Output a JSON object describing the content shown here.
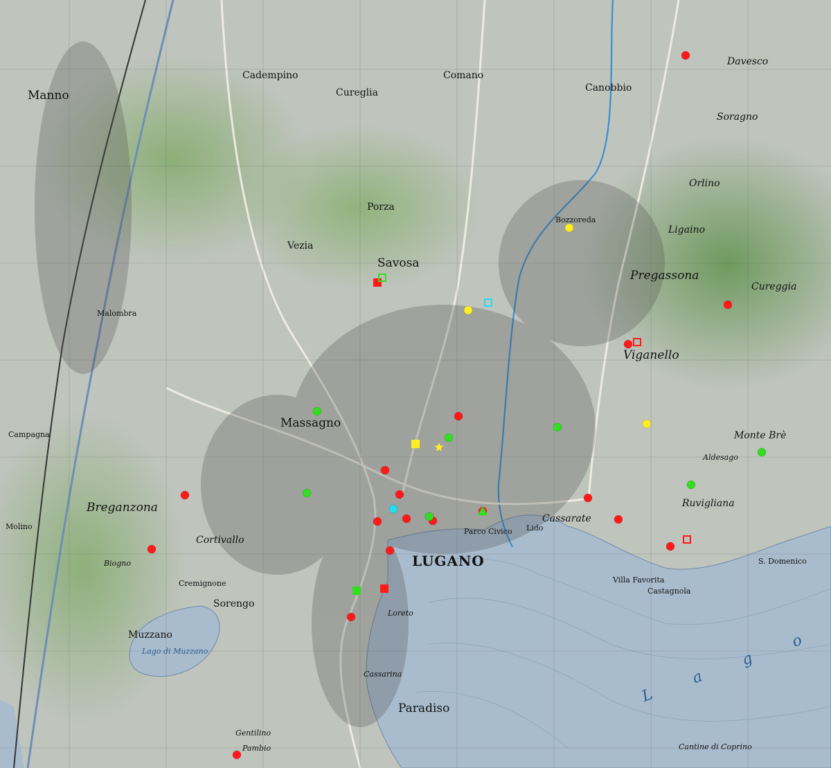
{
  "map": {
    "places": [
      {
        "name": "Manno",
        "style": "big"
      },
      {
        "name": "Cadempino",
        "style": "mid"
      },
      {
        "name": "Comano",
        "style": "mid"
      },
      {
        "name": "Cureglia",
        "style": "mid"
      },
      {
        "name": "Canobbio",
        "style": "mid"
      },
      {
        "name": "Davesco",
        "style": "mid it"
      },
      {
        "name": "Soragno",
        "style": "mid it"
      },
      {
        "name": "Orlino",
        "style": "mid it"
      },
      {
        "name": "Porza",
        "style": "mid"
      },
      {
        "name": "Vezia",
        "style": "mid"
      },
      {
        "name": "Savosa",
        "style": "big"
      },
      {
        "name": "Bozzoreda",
        "style": "sm"
      },
      {
        "name": "Ligaino",
        "style": "mid it"
      },
      {
        "name": "Pregassona",
        "style": "big it"
      },
      {
        "name": "Cureggia",
        "style": "mid it"
      },
      {
        "name": "Viganello",
        "style": "big it"
      },
      {
        "name": "Massagno",
        "style": "big"
      },
      {
        "name": "Monte Brè",
        "style": "mid it"
      },
      {
        "name": "Aldesago",
        "style": "sm it"
      },
      {
        "name": "Ruvigliana",
        "style": "mid it"
      },
      {
        "name": "Breganzona",
        "style": "big it"
      },
      {
        "name": "Cortivallo",
        "style": "mid it"
      },
      {
        "name": "Biogno",
        "style": "sm it"
      },
      {
        "name": "Cremignone",
        "style": "sm"
      },
      {
        "name": "Sorengo",
        "style": "mid"
      },
      {
        "name": "Cassarate",
        "style": "mid it"
      },
      {
        "name": "Lido",
        "style": "sm"
      },
      {
        "name": "LUGANO",
        "style": "lugano"
      },
      {
        "name": "Castagnola",
        "style": "sm"
      },
      {
        "name": "Villa Favorita",
        "style": "sm"
      },
      {
        "name": "S. Domenico",
        "style": "sm"
      },
      {
        "name": "Loreto",
        "style": "sm it"
      },
      {
        "name": "Muzzano",
        "style": "mid"
      },
      {
        "name": "Lago di Muzzano",
        "style": "sm water"
      },
      {
        "name": "Cassarina",
        "style": "sm it"
      },
      {
        "name": "Paradiso",
        "style": "big"
      },
      {
        "name": "Gentilino",
        "style": "sm it"
      },
      {
        "name": "Pambio",
        "style": "sm it"
      },
      {
        "name": "Cantine di Coprino",
        "style": "sm it"
      },
      {
        "name": "Malombra",
        "style": "sm"
      },
      {
        "name": "Campagna",
        "style": "sm"
      },
      {
        "name": "Molino",
        "style": "sm"
      },
      {
        "name": "Parco Civico",
        "style": "sm"
      }
    ],
    "lake_label": "L a g o",
    "markers": [
      {
        "type": "dot",
        "color": "#ff1a1a"
      },
      {
        "type": "dot",
        "color": "#ff1a1a"
      },
      {
        "type": "dot",
        "color": "#ff1a1a"
      },
      {
        "type": "dot",
        "color": "#ff1a1a"
      },
      {
        "type": "dot",
        "color": "#ff1a1a"
      },
      {
        "type": "dot",
        "color": "#ff1a1a"
      },
      {
        "type": "dot",
        "color": "#ff1a1a"
      },
      {
        "type": "dot",
        "color": "#ff1a1a"
      },
      {
        "type": "dot",
        "color": "#ff1a1a"
      },
      {
        "type": "dot",
        "color": "#ff1a1a"
      },
      {
        "type": "dot",
        "color": "#ff1a1a"
      },
      {
        "type": "dot",
        "color": "#ff1a1a"
      },
      {
        "type": "dot",
        "color": "#ff1a1a"
      },
      {
        "type": "dot",
        "color": "#ff1a1a"
      },
      {
        "type": "dot",
        "color": "#ff1a1a"
      },
      {
        "type": "dot",
        "color": "#ff1a1a"
      },
      {
        "type": "dot",
        "color": "#ff1a1a"
      },
      {
        "type": "dot",
        "color": "#ff1a1a"
      },
      {
        "type": "dot",
        "color": "#ff1a1a"
      },
      {
        "type": "dot",
        "color": "#ff1a1a"
      },
      {
        "type": "dot",
        "color": "#ff1a1a"
      },
      {
        "type": "dot",
        "color": "#33dd22"
      },
      {
        "type": "dot",
        "color": "#33dd22"
      },
      {
        "type": "dot",
        "color": "#33dd22"
      },
      {
        "type": "dot",
        "color": "#33dd22"
      },
      {
        "type": "dot",
        "color": "#33dd22"
      },
      {
        "type": "dot",
        "color": "#33dd22"
      },
      {
        "type": "dot",
        "color": "#33dd22"
      },
      {
        "type": "dot",
        "color": "#33dd22"
      },
      {
        "type": "dot",
        "color": "#ffee22"
      },
      {
        "type": "dot",
        "color": "#ffee22"
      },
      {
        "type": "dot",
        "color": "#ffee22"
      },
      {
        "type": "square",
        "color": "#ffee22"
      },
      {
        "type": "star",
        "color": "#ffee22"
      },
      {
        "type": "dot",
        "color": "#22ddee"
      },
      {
        "type": "square-outline",
        "color": "#22ddee"
      },
      {
        "type": "square-outline",
        "color": "#ff1a1a"
      },
      {
        "type": "square-outline",
        "color": "#ff1a1a"
      },
      {
        "type": "square",
        "color": "#ff1a1a"
      },
      {
        "type": "square",
        "color": "#ff1a1a"
      },
      {
        "type": "square",
        "color": "#33dd22"
      },
      {
        "type": "square-outline",
        "color": "#33dd22"
      },
      {
        "type": "triangle",
        "color": "#33dd22"
      }
    ]
  }
}
